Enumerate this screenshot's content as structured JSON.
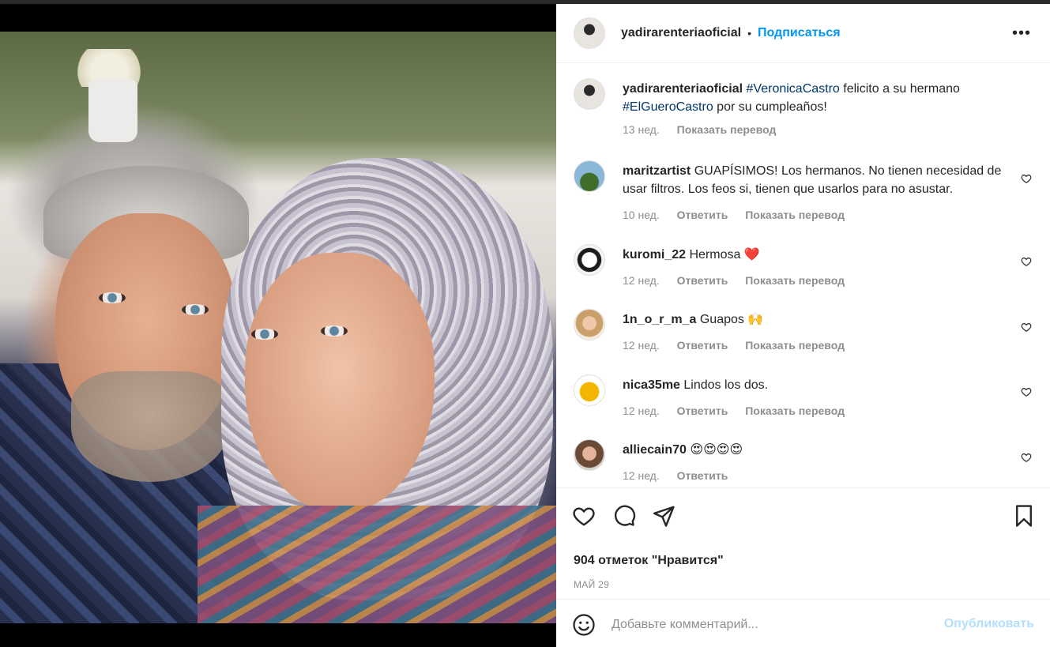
{
  "post": {
    "username": "yadirarenteriaoficial",
    "separator": "•",
    "follow_label": "Подписаться",
    "more_label": "•••"
  },
  "caption": {
    "username": "yadirarenteriaoficial",
    "tag1": "#VeronicaCastro",
    "text1": " felicito a su hermano ",
    "tag2": "#ElGueroCastro",
    "text2": " por su cumpleaños!",
    "time": "13 нед.",
    "translate": "Показать перевод"
  },
  "comments": [
    {
      "username": "maritzartist",
      "text": "GUAPÍSIMOS! Los hermanos. No tienen necesidad de usar filtros. Los feos si, tienen que usarlos para no asustar.",
      "time": "10 нед.",
      "reply": "Ответить",
      "translate": "Показать перевод"
    },
    {
      "username": "kuromi_22",
      "text": "Hermosa ❤️",
      "time": "12 нед.",
      "reply": "Ответить",
      "translate": "Показать перевод"
    },
    {
      "username": "1n_o_r_m_a",
      "text": "Guapos 🙌",
      "time": "12 нед.",
      "reply": "Ответить",
      "translate": "Показать перевод"
    },
    {
      "username": "nica35me",
      "text": "Lindos los dos.",
      "time": "12 нед.",
      "reply": "Ответить",
      "translate": "Показать перевод"
    },
    {
      "username": "alliecain70",
      "text": "😍😍😍😍",
      "time": "12 нед.",
      "reply": "Ответить"
    }
  ],
  "actions": {
    "icons": [
      "heart-icon",
      "comment-icon",
      "share-icon",
      "bookmark-icon"
    ],
    "likes": "904 отметок \"Нравится\"",
    "date": "МАЙ 29"
  },
  "add_comment": {
    "placeholder": "Добавьте комментарий...",
    "post_label": "Опубликовать"
  },
  "colors": {
    "link": "#0095f6",
    "hashtag": "#00376b",
    "muted": "#8e8e8e",
    "post_disabled": "#b2dffc",
    "emoji_heart": "#e0245e"
  }
}
